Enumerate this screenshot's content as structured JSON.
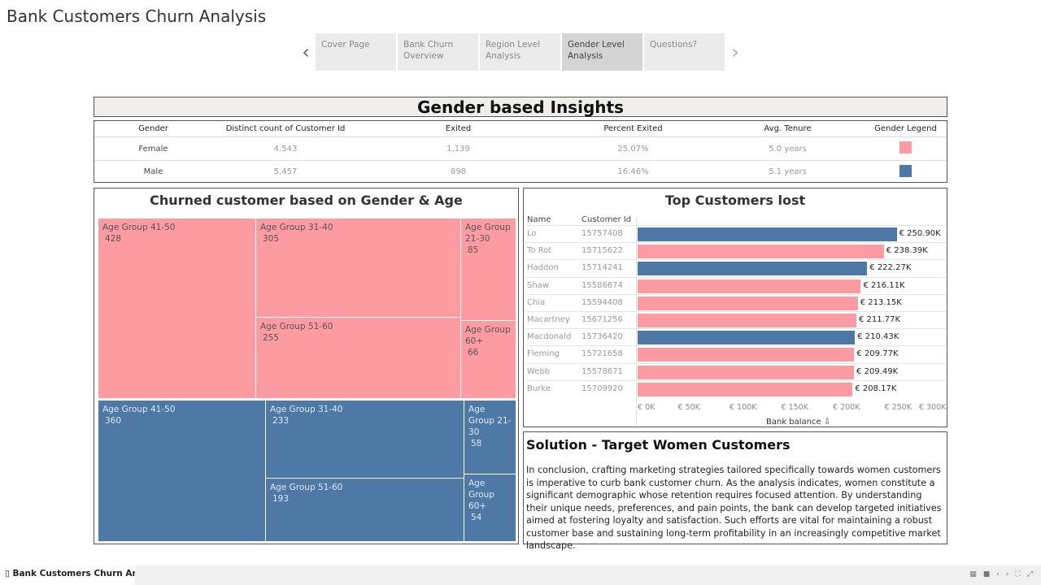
{
  "app": {
    "title": "Bank Customers Churn Analysis"
  },
  "nav": {
    "tabs": [
      {
        "label": "Cover Page"
      },
      {
        "label": "Bank Churn Overview"
      },
      {
        "label": "Region Level Analysis"
      },
      {
        "label": "Gender Level Analysis"
      },
      {
        "label": "Questions?"
      }
    ],
    "prev_icon": "chevron-left-icon",
    "next_icon": "chevron-right-icon"
  },
  "insights": {
    "title": "Gender based Insights",
    "headers": [
      "Gender",
      "Distinct count of Customer Id",
      "Exited",
      "Percent Exited",
      "Avg. Tenure",
      "Gender Legend"
    ],
    "rows": [
      {
        "gender": "Female",
        "count": "4,543",
        "exited": "1,139",
        "percent": "25.07%",
        "tenure": "5.0 years",
        "color": "#fd9ba3"
      },
      {
        "gender": "Male",
        "count": "5,457",
        "exited": "898",
        "percent": "16.46%",
        "tenure": "5.1 years",
        "color": "#4e79a7"
      }
    ]
  },
  "treemap": {
    "title": "Churned customer based on Gender & Age",
    "female": [
      {
        "label": "Age Group 41-50",
        "value": "428"
      },
      {
        "label": "Age Group 31-40",
        "value": "305"
      },
      {
        "label": "Age Group 21-30",
        "value": "85"
      },
      {
        "label": "Age Group 51-60",
        "value": "255"
      },
      {
        "label": "Age Group 60+",
        "value": "66"
      }
    ],
    "male": [
      {
        "label": "Age Group 41-50",
        "value": "360"
      },
      {
        "label": "Age Group 31-40",
        "value": "233"
      },
      {
        "label": "Age Group 21-30",
        "value": "58"
      },
      {
        "label": "Age Group 51-60",
        "value": "193"
      },
      {
        "label": "Age Group 60+",
        "value": "54"
      }
    ],
    "colors": {
      "female": "#fd9ba3",
      "male": "#4e79a7"
    }
  },
  "top_customers": {
    "title": "Top Customers lost",
    "col_name": "Name",
    "col_id": "Customer Id",
    "axis_title": "Bank balance",
    "ticks": [
      "€ 0K",
      "€ 50K",
      "€ 100K",
      "€ 150K",
      "€ 200K",
      "€ 250K",
      "€ 300K"
    ],
    "rows": [
      {
        "name": "Lo",
        "id": "15757408",
        "value": 250.9,
        "label": "€ 250.90K",
        "gender": "male"
      },
      {
        "name": "To Rot",
        "id": "15715622",
        "value": 238.39,
        "label": "€ 238.39K",
        "gender": "female"
      },
      {
        "name": "Haddon",
        "id": "15714241",
        "value": 222.27,
        "label": "€ 222.27K",
        "gender": "male"
      },
      {
        "name": "Shaw",
        "id": "15586674",
        "value": 216.11,
        "label": "€ 216.11K",
        "gender": "female"
      },
      {
        "name": "Chia",
        "id": "15594408",
        "value": 213.15,
        "label": "€ 213.15K",
        "gender": "female"
      },
      {
        "name": "Macartney",
        "id": "15671256",
        "value": 211.77,
        "label": "€ 211.77K",
        "gender": "female"
      },
      {
        "name": "Macdonald",
        "id": "15736420",
        "value": 210.43,
        "label": "€ 210.43K",
        "gender": "male"
      },
      {
        "name": "Fleming",
        "id": "15721658",
        "value": 209.77,
        "label": "€ 209.77K",
        "gender": "female"
      },
      {
        "name": "Webb",
        "id": "15578671",
        "value": 209.49,
        "label": "€ 209.49K",
        "gender": "female"
      },
      {
        "name": "Burke",
        "id": "15709920",
        "value": 208.17,
        "label": "€ 208.17K",
        "gender": "female"
      }
    ]
  },
  "chart_data": {
    "type": "bar",
    "title": "Top Customers lost",
    "categories": [
      "Lo",
      "To Rot",
      "Haddon",
      "Shaw",
      "Chia",
      "Macartney",
      "Macdonald",
      "Fleming",
      "Webb",
      "Burke"
    ],
    "values": [
      250.9,
      238.39,
      222.27,
      216.11,
      213.15,
      211.77,
      210.43,
      209.77,
      209.49,
      208.17
    ],
    "xlabel": "Bank balance",
    "xlim": [
      0,
      300
    ]
  },
  "solution": {
    "title": "Solution - Target Women Customers",
    "body": "In conclusion, crafting marketing strategies tailored specifically towards women customers is imperative to curb bank customer churn. As the analysis indicates, women constitute a significant demographic whose retention requires focused attention. By understanding their unique needs, preferences, and pain points, the bank can develop targeted initiatives aimed at fostering loyalty and satisfaction. Such efforts are vital for maintaining a robust customer base and sustaining long-term profitability in an increasingly competitive market landscape."
  },
  "footer": {
    "sheet_tab": "Bank Customers Churn Anal..."
  }
}
